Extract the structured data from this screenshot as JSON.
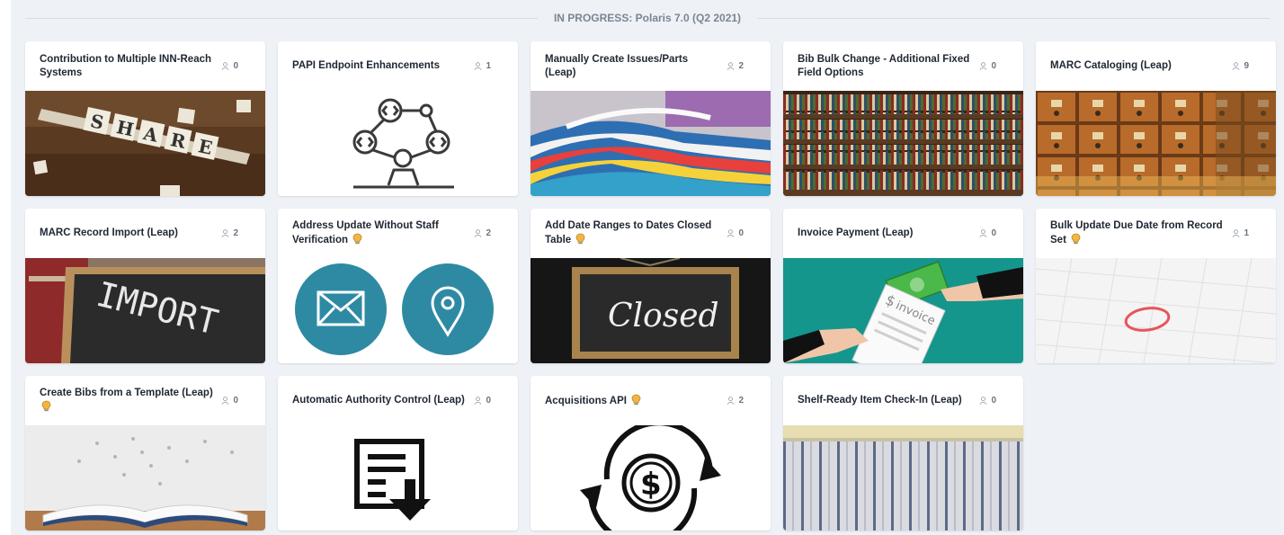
{
  "section": {
    "title": "IN PROGRESS: Polaris 7.0 (Q2 2021)"
  },
  "cards": [
    {
      "title": "Contribution to Multiple INN-Reach Systems",
      "count": "0",
      "tiles": [
        "S",
        "H",
        "A",
        "R",
        "E"
      ]
    },
    {
      "title": "PAPI Endpoint Enhancements",
      "count": "1"
    },
    {
      "title": "Manually Create Issues/Parts (Leap)",
      "count": "2"
    },
    {
      "title": "Bib Bulk Change - Additional Fixed Field Options",
      "count": "0"
    },
    {
      "title": "MARC Cataloging (Leap)",
      "count": "9"
    },
    {
      "title": "MARC Record Import (Leap)",
      "count": "2",
      "image_text": "IMPORT"
    },
    {
      "title": "Address Update Without Staff Verification",
      "count": "2"
    },
    {
      "title": "Add Date Ranges to Dates Closed Table",
      "count": "0",
      "image_text": "Closed"
    },
    {
      "title": "Invoice Payment (Leap)",
      "count": "0",
      "image_text": "invoice"
    },
    {
      "title": "Bulk Update Due Date from Record Set",
      "count": "1"
    },
    {
      "title": "Create Bibs from a Template (Leap)",
      "count": "0"
    },
    {
      "title": "Automatic Authority Control (Leap)",
      "count": "0"
    },
    {
      "title": "Acquisitions API",
      "count": "2"
    },
    {
      "title": "Shelf-Ready Item Check-In (Leap)",
      "count": "0"
    }
  ],
  "colors": {
    "accent_teal": "#2e8aa3",
    "bulb": "#f2b640"
  }
}
